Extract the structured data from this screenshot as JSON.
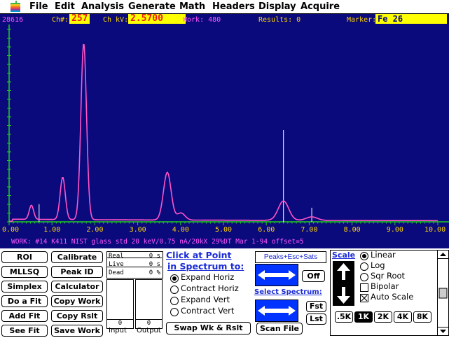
{
  "menubar": {
    "items": [
      "File",
      "Edit",
      "Analysis",
      "Generate",
      "Math",
      "Headers",
      "Display",
      "Acquire"
    ]
  },
  "header": {
    "count": "28616",
    "ch_label": "Ch#:",
    "ch_value": "257",
    "kv_label": "Ch kV:",
    "kv_value": "2.5700",
    "work": "Work: 480",
    "results": "Results: 0",
    "marker_label": "Marker:",
    "marker_value": "Fe   26"
  },
  "axis": {
    "ticks": [
      "0.00",
      "1.00",
      "2.00",
      "3.00",
      "4.00",
      "5.00",
      "6.00",
      "7.00",
      "8.00",
      "9.00",
      "10.00"
    ]
  },
  "chart_data": {
    "type": "line",
    "x_range": [
      0,
      10
    ],
    "series": [
      {
        "peaks": [
          {
            "x": 0.52,
            "y": 0.08
          },
          {
            "x": 1.25,
            "y": 0.24
          },
          {
            "x": 1.74,
            "y": 1.0
          },
          {
            "x": 3.69,
            "y": 0.27
          },
          {
            "x": 4.01,
            "y": 0.04
          },
          {
            "x": 6.4,
            "y": 0.11
          },
          {
            "x": 7.06,
            "y": 0.02
          }
        ]
      }
    ],
    "marker_lines": [
      {
        "x": 0.7,
        "y": 0.1
      },
      {
        "x": 6.4,
        "y": 0.52
      },
      {
        "x": 7.06,
        "y": 0.08
      }
    ]
  },
  "work_line": "WORK: #14  K411 NIST glass std 20 keV/0.75 nA/20kX 29%DT Mar 1-94 offset=5",
  "buttons": {
    "roi": "ROI",
    "calibrate": "Calibrate",
    "mllsq": "MLLSQ",
    "peak_id": "Peak ID",
    "simplex": "Simplex",
    "calculator": "Calculator",
    "do_a_fit": "Do a Fit",
    "copy_work": "Copy Work",
    "add_fit": "Add Fit",
    "copy_rslt": "Copy Rslt",
    "see_fit": "See Fit",
    "save_work": "Save Work"
  },
  "counters": {
    "real_label": "Real",
    "real_value": "0 s",
    "live_label": "Live",
    "live_value": "0 s",
    "dead_label": "Dead",
    "dead_value": "0 %",
    "input_value": "0",
    "output_value": "0",
    "input_label": "Input",
    "output_label": "Output"
  },
  "click_at_point": {
    "title_line1": "Click at Point",
    "title_line2": "in Spectrum to:",
    "options": [
      "Expand Horiz",
      "Contract Horiz",
      "Expand Vert",
      "Contract Vert"
    ],
    "selected": 0,
    "swap_button": "Swap Wk & Rslt"
  },
  "peaks_box": {
    "title": "Peaks+Esc+Sats",
    "off_button": "Off",
    "select_spectrum": "Select Spectrum:",
    "fst_button": "Fst",
    "lst_button": "Lst",
    "scan_file_button": "Scan File"
  },
  "scale": {
    "title": "Scale",
    "options": [
      "Linear",
      "Log",
      "Sqr Root"
    ],
    "selected": 0,
    "bipolar_label": "Bipolar",
    "bipolar_checked": false,
    "autoscale_label": "Auto Scale",
    "autoscale_checked": true,
    "ranges": [
      ".5K",
      "1K",
      "2K",
      "4K",
      "8K"
    ],
    "range_selected": 1
  },
  "colors": {
    "background": "#0a0a7c",
    "spectrum": "#ff55c8",
    "axis": "#22cc22",
    "ticks_text": "#ffd400",
    "header_text": "#ffd400",
    "highlight": "#ffff00",
    "marker_text": "#0a0a7c"
  }
}
